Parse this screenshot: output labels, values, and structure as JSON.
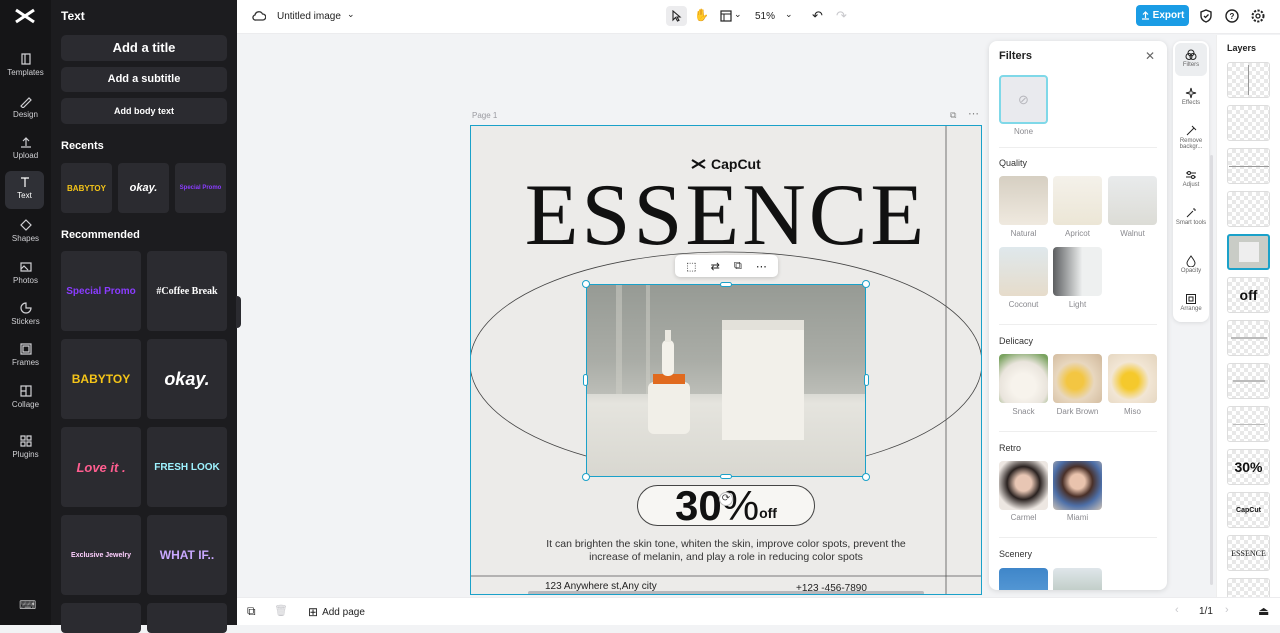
{
  "app": {
    "doc_title": "Untitled image",
    "zoom": "51%",
    "export_label": "Export",
    "page_label": "Page 1",
    "add_page_label": "Add page",
    "page_count": "1/1",
    "accent": "#1a9ce5"
  },
  "rail": {
    "items": [
      {
        "label": "Templates",
        "icon": "templates-icon"
      },
      {
        "label": "Design",
        "icon": "design-icon"
      },
      {
        "label": "Upload",
        "icon": "upload-icon"
      },
      {
        "label": "Text",
        "icon": "text-icon"
      },
      {
        "label": "Shapes",
        "icon": "shapes-icon"
      },
      {
        "label": "Photos",
        "icon": "photos-icon"
      },
      {
        "label": "Stickers",
        "icon": "stickers-icon"
      },
      {
        "label": "Frames",
        "icon": "frames-icon"
      },
      {
        "label": "Collage",
        "icon": "collage-icon"
      },
      {
        "label": "Plugins",
        "icon": "plugins-icon"
      }
    ]
  },
  "text_panel": {
    "title": "Text",
    "add_title": "Add a title",
    "add_subtitle": "Add a subtitle",
    "add_body": "Add body text",
    "recents_title": "Recents",
    "recents": [
      "BABYTOY",
      "okay.",
      "Special Promo"
    ],
    "recommended_title": "Recommended",
    "recommended": [
      "Special Promo",
      "#Coffee Break",
      "BABYTOY",
      "okay.",
      "Love it .",
      "FRESH LOOK",
      "Exclusive Jewelry",
      "WHAT IF.."
    ]
  },
  "design": {
    "brand": "CapCut",
    "headline": "ESSENCE",
    "badge_number": "30",
    "badge_percent": "%",
    "badge_off": "off",
    "body": "It can brighten the skin tone, whiten the skin, improve color spots, prevent the increase of melanin, and play a role in reducing color spots",
    "address": "123 Anywhere st,Any city",
    "phone": "+123 -456-7890"
  },
  "filters": {
    "title": "Filters",
    "none_label": "None",
    "sections": [
      {
        "title": "Quality",
        "items": [
          "Natural",
          "Apricot",
          "Walnut",
          "Coconut",
          "Light"
        ]
      },
      {
        "title": "Delicacy",
        "items": [
          "Snack",
          "Dark Brown",
          "Miso"
        ]
      },
      {
        "title": "Retro",
        "items": [
          "Carmel",
          "Miami"
        ]
      },
      {
        "title": "Scenery",
        "items": []
      }
    ]
  },
  "tools": {
    "items": [
      "Filters",
      "Effects",
      "Remove backgr...",
      "Adjust",
      "Smart tools",
      "Opacity",
      "Arrange"
    ]
  },
  "layers": {
    "title": "Layers",
    "texts": [
      "off",
      "30%",
      "CapCut",
      "ESSENCE"
    ]
  }
}
